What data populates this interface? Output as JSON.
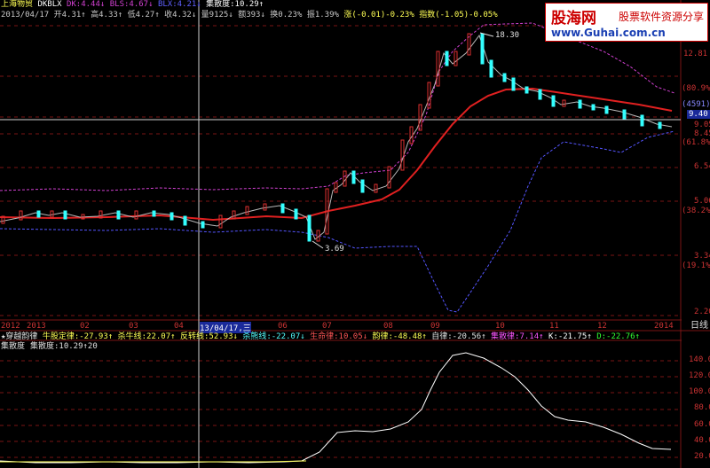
{
  "colors": {
    "bg": "#000000",
    "red": "#e02020",
    "boll": "#5555ff",
    "purple": "#d040d0",
    "yellow": "#ffff55",
    "cyan": "#55ffff",
    "green": "#33ff33",
    "grid": "#7a1515",
    "white": "#ffffff"
  },
  "header": {
    "stock_name": "上海物贸",
    "indicator": "DKBLX",
    "dk": "DK:4.44↓",
    "bls": "BLS:4.67↓",
    "blx": "BLX:4.21↓",
    "jsd_top": "集散度:10.29↑"
  },
  "info_bar": {
    "date": "2013/04/17",
    "open": "开4.31↑",
    "high": "高4.33↑",
    "low": "低4.27↑",
    "close": "收4.32↓",
    "volume": "量9125↓",
    "amount": "额393↓",
    "turnover": "换0.23%",
    "amplitude": "振1.39%",
    "change": "涨(-0.01)-0.23%",
    "index": "指数(-1.05)-0.05%"
  },
  "watermark": {
    "title": "股海网",
    "subtitle": "股票软件资源分享",
    "url": "www.Guhai.com.cn"
  },
  "price_axis": {
    "ticks": [
      "12.81",
      "9.40",
      "9.05",
      "8.45",
      "6.54",
      "5.06",
      "3.34",
      "2.20"
    ],
    "pcts": [
      "(80.9%)",
      "(4591)",
      "(61.8%)",
      "(38.2%)",
      "(19.1%)"
    ]
  },
  "annotations": {
    "high": "18.30",
    "low": "3.69"
  },
  "time_axis": {
    "labels": [
      "2012",
      "2013",
      "02",
      "03",
      "04",
      "13/04/17,三",
      "06",
      "07",
      "08",
      "09",
      "10",
      "11",
      "12",
      "2014"
    ],
    "period": "日线"
  },
  "indicator_bar": {
    "name": "★穿越韵律",
    "a": "牛股定律:-27.93↑",
    "b": "杀牛线:22.07↑",
    "c": "反转线:52.93↓",
    "d": "杀熊线:-22.07↓",
    "e": "生命律:10.05↓",
    "f": "韵律:-48.48↑",
    "g": "自律:-20.56↑",
    "h": "集散律:7.14↑",
    "k": "K:-21.75↑",
    "dd": "D:-22.76↑"
  },
  "sub_panel": {
    "title": "集散度",
    "label": "集散度:10.29↑20",
    "ticks": [
      "140.00",
      "120.00",
      "100.00",
      "80.00",
      "60.00",
      "40.00",
      "20.00"
    ]
  }
}
